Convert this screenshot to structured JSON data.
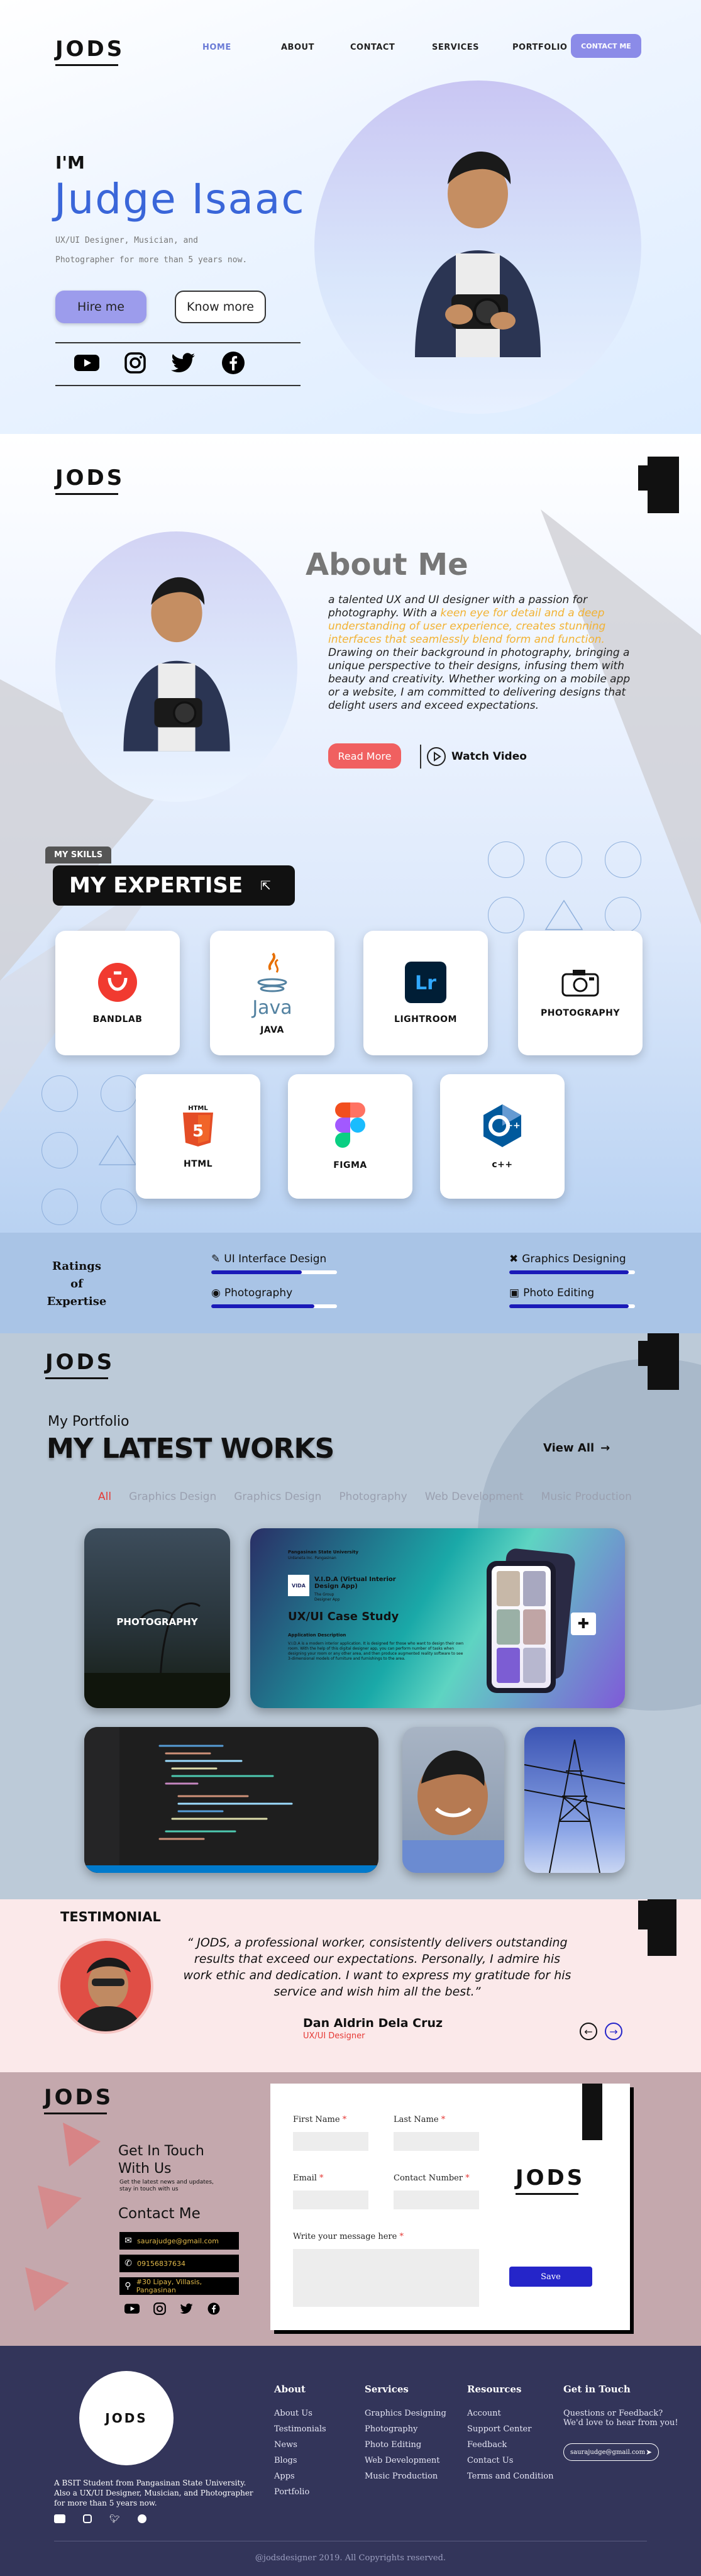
{
  "brand": {
    "logo": "JODS"
  },
  "nav": {
    "items": [
      "HOME",
      "ABOUT",
      "CONTACT",
      "SERVICES",
      "PORTFOLIO"
    ],
    "cta": "CONTACT ME"
  },
  "hero": {
    "greeting": "I'M",
    "name": "Judge Isaac",
    "tagline_1": "UX/UI Designer, Musician, and",
    "tagline_2": "Photographer for more than 5 years now.",
    "hire_btn": "Hire me",
    "know_btn": "Know more",
    "socials": [
      "youtube-icon",
      "instagram-icon",
      "twitter-icon",
      "facebook-icon"
    ]
  },
  "about": {
    "title": "About Me",
    "text_1": "a talented UX and UI designer with a passion for photography. With a ",
    "highlight": "keen eye for detail and a deep understanding of user experience, creates stunning interfaces that seamlessly blend form and function.",
    "text_2": " Drawing on their background in photography, bringing a unique perspective to their designs, infusing them with beauty and creativity. Whether working on a mobile app or a website, I am committed to delivering designs that delight users and exceed expectations.",
    "read_more": "Read More",
    "watch_video": "Watch Video"
  },
  "skills": {
    "badge": "MY SKILLS",
    "title": "MY EXPERTISE",
    "cards": [
      "BANDLAB",
      "JAVA",
      "LIGHTROOM",
      "PHOTOGRAPHY",
      "HTML",
      "FIGMA",
      "c++"
    ]
  },
  "ratings": {
    "label_1": "Ratings",
    "label_2": "of",
    "label_3": "Expertise",
    "items": [
      {
        "name": "UI Interface Design",
        "level": 0.72
      },
      {
        "name": "Graphics Designing",
        "level": 0.95
      },
      {
        "name": "Photography",
        "level": 0.82
      },
      {
        "name": "Photo Editing",
        "level": 0.95
      }
    ]
  },
  "portfolio": {
    "subtitle": "My Portfolio",
    "title": "MY LATEST WORKS",
    "view_all": "View All",
    "tabs": [
      "All",
      "Graphics Design",
      "Graphics Design",
      "Photography",
      "Web Development",
      "Music Production"
    ],
    "tile_photo": "PHOTOGRAPHY",
    "case": {
      "school": "Pangasinan State University",
      "campus": "Urdaneta Inc. Pangasinan",
      "app": "V.I.D.A (Virtual Interior Design App)",
      "by": "The Group",
      "role": "Designer App",
      "title": "UX/UI Case Study",
      "desc_head": "Application Description",
      "desc": "V.I.D.A is a modern interior application. It is designed for those who want to design their own room. With the help of this digital designer app, you can perform number of tasks when designing your room or any other area, and then produce augmented reality software to see 3-dimensional models of furniture and furnishings to the area."
    }
  },
  "testimonial": {
    "heading": "TESTIMONIAL",
    "quote": "“ JODS, a professional worker, consistently delivers outstanding results that exceed our expectations. Personally, I admire his work ethic and dedication. I want to express my gratitude for his service and wish him all the best.”",
    "name": "Dan Aldrin Dela Cruz",
    "role": "UX/UI Designer"
  },
  "contact": {
    "touch_1": "Get In Touch",
    "touch_2": "With Us",
    "touch_sub": "Get the latest news and updates, stay in touch with us",
    "title": "Contact Me",
    "email": "saurajudge@gmail.com",
    "phone": "09156837634",
    "address": "#30 Lipay, Villasis, Pangasinan",
    "form": {
      "first_name": "First Name",
      "last_name": "Last Name",
      "email": "Email",
      "contact_number": "Contact Number",
      "message": "Write your message here",
      "submit": "Save"
    }
  },
  "footer": {
    "logo": "JODS",
    "bio": "A BSIT Student from Pangasinan State University. Also a UX/UI Designer, Musician, and Photographer for more than 5 years now.",
    "about_title": "About",
    "about_links": [
      "About Us",
      "Testimonials",
      "News",
      "Blogs",
      "Apps",
      "Portfolio"
    ],
    "services_title": "Services",
    "services_links": [
      "Graphics Designing",
      "Photography",
      "Photo Editing",
      "Web Development",
      "Music Production"
    ],
    "resources_title": "Resources",
    "resources_links": [
      "Account",
      "Support Center",
      "Feedback",
      "Contact Us",
      "Terms and Condition"
    ],
    "touch_title": "Get in Touch",
    "touch_text_1": "Questions or Feedback?",
    "touch_text_2": "We'd love to hear from you!",
    "email_placeholder": "saurajudge@gmail.com",
    "copyright": "@jodsdesigner 2019. All Copyrights reserved."
  },
  "colors": {
    "accent": "#8b8be8",
    "primary_blue": "#3a66d9",
    "red": "#e53935",
    "navy": "#33355a",
    "pink_bg": "#c4a8ad"
  }
}
